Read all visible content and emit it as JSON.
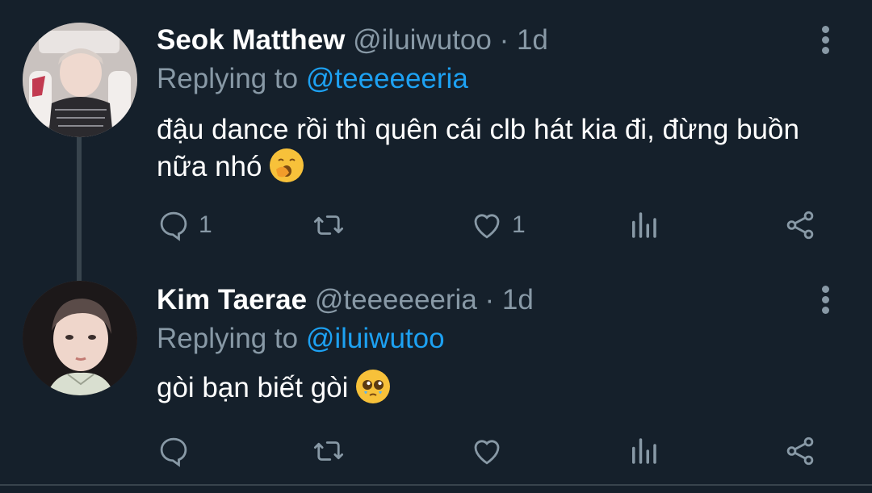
{
  "tweets": [
    {
      "name": "Seok Matthew",
      "handle": "@iluiwutoo",
      "separator": "·",
      "time": "1d",
      "replying_prefix": "Replying to",
      "replying_to": "@teeeeeeria",
      "text": "đậu dance rồi thì quên cái clb hát kia đi, đừng buồn nữa nhó",
      "emoji": "yawning-face-emoji",
      "actions": {
        "reply_count": "1",
        "retweet_count": "",
        "like_count": "1"
      }
    },
    {
      "name": "Kim Taerae",
      "handle": "@teeeeeeria",
      "separator": "·",
      "time": "1d",
      "replying_prefix": "Replying to",
      "replying_to": "@iluiwutoo",
      "text": "gòi bạn biết gòi",
      "emoji": "pleading-face-emoji",
      "actions": {
        "reply_count": "",
        "retweet_count": "",
        "like_count": ""
      }
    }
  ],
  "icons": [
    "reply-icon",
    "retweet-icon",
    "like-icon",
    "analytics-icon",
    "share-icon",
    "more-icon"
  ],
  "colors": {
    "background": "#15202b",
    "secondary_text": "#8899a6",
    "link": "#1da1f2",
    "thread_line": "#38444d"
  }
}
